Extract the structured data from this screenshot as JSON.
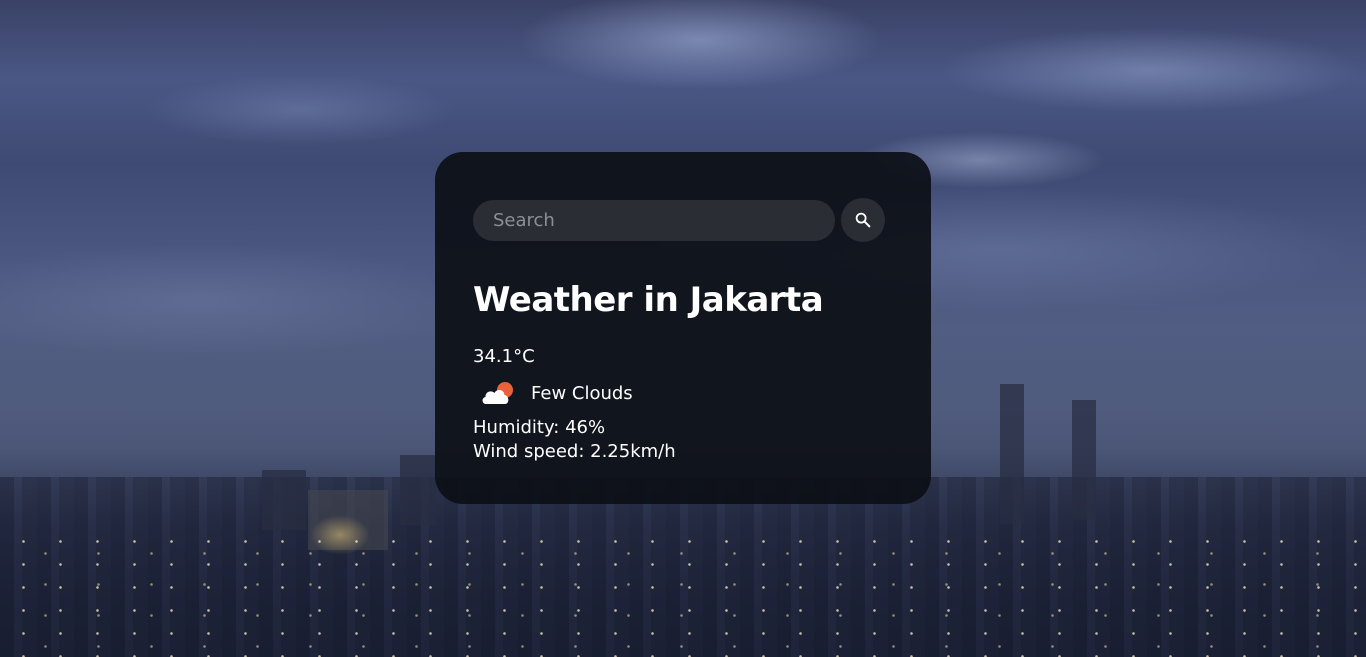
{
  "search": {
    "placeholder": "Search",
    "value": "",
    "button_icon": "search-icon"
  },
  "weather": {
    "title": "Weather in Jakarta",
    "temperature": "34.1°C",
    "icon": "few-clouds-day-icon",
    "description": "Few Clouds",
    "humidity": "Humidity: 46%",
    "wind": "Wind speed: 2.25km/h"
  },
  "colors": {
    "card_background": "#0c0f16",
    "input_background": "#2a2d33",
    "text": "#ffffff",
    "placeholder": "#8c8f96",
    "sun": "#e8623a",
    "cloud": "#ffffff"
  }
}
